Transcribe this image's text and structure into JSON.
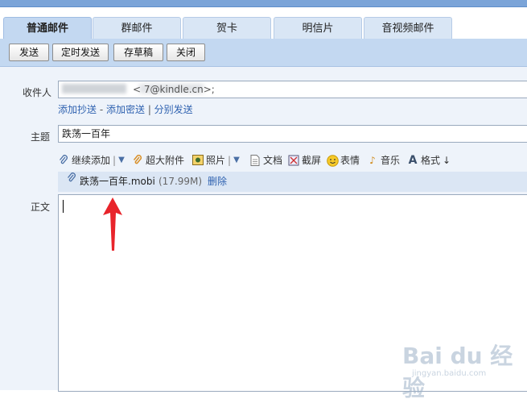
{
  "tabs": [
    {
      "label": "普通邮件",
      "active": true
    },
    {
      "label": "群邮件",
      "active": false
    },
    {
      "label": "贺卡",
      "active": false
    },
    {
      "label": "明信片",
      "active": false
    },
    {
      "label": "音视频邮件",
      "active": false
    }
  ],
  "toolbar": {
    "send": "发送",
    "scheduled": "定时发送",
    "draft": "存草稿",
    "close": "关闭"
  },
  "recipient": {
    "label": "收件人",
    "value_visible": "<                    7@kindle.cn>;"
  },
  "recipient_links": {
    "add_cc": "添加抄送",
    "dash": " - ",
    "add_bcc": "添加密送",
    "pipe": " | ",
    "separate": "分别发送"
  },
  "subject": {
    "label": "主题",
    "value": "跌荡一百年"
  },
  "attach_toolbar": {
    "continue_add": "继续添加",
    "large_attach": "超大附件",
    "photo": "照片",
    "doc": "文档",
    "screenshot": "截屏",
    "emoji": "表情",
    "music": "音乐",
    "format": "格式"
  },
  "attachment": {
    "name": "跌荡一百年.mobi",
    "size": "(17.99M)",
    "delete": "删除"
  },
  "body": {
    "label": "正文"
  },
  "watermark": {
    "line1": "Bai du 经验",
    "line2": "jingyan.baidu.com"
  },
  "colors": {
    "accent": "#2f62b0",
    "toolbar_bg": "#c3d8f1",
    "arrow": "#e8242b"
  }
}
